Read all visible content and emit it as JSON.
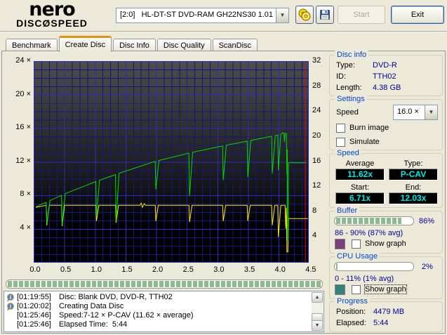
{
  "toolbar": {
    "logo_top": "nero",
    "logo_bottom": "DISCØSPEED",
    "drive_selector": "[2:0]   HL-DT-ST DVD-RAM GH22NS30 1.01",
    "start_label": "Start",
    "exit_label": "Exit"
  },
  "tabs": {
    "items": [
      {
        "label": "Benchmark",
        "active": false
      },
      {
        "label": "Create Disc",
        "active": true
      },
      {
        "label": "Disc Info",
        "active": false
      },
      {
        "label": "Disc Quality",
        "active": false
      },
      {
        "label": "ScanDisc",
        "active": false
      }
    ]
  },
  "chart_data": {
    "type": "line",
    "title": "Create Disc write transfer graph",
    "x_ticks": [
      "0.0",
      "0.5",
      "1.0",
      "1.5",
      "2.0",
      "2.5",
      "3.0",
      "3.5",
      "4.0",
      "4.5"
    ],
    "x_unit": "GB",
    "left_axis": {
      "suffix": "×",
      "ticks": [
        24,
        20,
        16,
        12,
        8,
        4
      ],
      "range": [
        0,
        24
      ]
    },
    "right_axis": {
      "ticks": [
        32,
        28,
        24,
        20,
        16,
        12,
        8,
        4
      ],
      "range": [
        0,
        32
      ]
    },
    "grid": true,
    "capacity_marker_gb": 4.4,
    "capacity_marker_color": "#d41414",
    "series": [
      {
        "name": "rotation-speed-line",
        "color": "#ffe800",
        "axis": "left",
        "points": [
          [
            0,
            6.55
          ],
          [
            0.17,
            6.8
          ],
          [
            0.18,
            4.4
          ],
          [
            0.22,
            6.8
          ],
          [
            0.42,
            6.8
          ],
          [
            0.43,
            4.3
          ],
          [
            0.47,
            6.8
          ],
          [
            0.98,
            6.8
          ],
          [
            0.99,
            4.9
          ],
          [
            1.03,
            6.8
          ],
          [
            1.3,
            6.8
          ],
          [
            1.31,
            4.7
          ],
          [
            1.35,
            6.8
          ],
          [
            1.7,
            6.8
          ],
          [
            1.72,
            7.05
          ],
          [
            1.74,
            6.55
          ],
          [
            1.77,
            7.0
          ],
          [
            1.79,
            6.8
          ],
          [
            1.95,
            6.8
          ],
          [
            1.96,
            4.9
          ],
          [
            2.0,
            6.8
          ],
          [
            2.5,
            6.8
          ],
          [
            2.51,
            4.8
          ],
          [
            2.55,
            6.8
          ],
          [
            3.05,
            6.8
          ],
          [
            3.06,
            4.9
          ],
          [
            3.1,
            6.8
          ],
          [
            3.45,
            6.8
          ],
          [
            3.46,
            4.9
          ],
          [
            3.5,
            6.8
          ],
          [
            3.85,
            6.8
          ],
          [
            3.86,
            4.4
          ],
          [
            3.9,
            6.8
          ],
          [
            3.95,
            6.8
          ],
          [
            3.96,
            3.0
          ],
          [
            4.0,
            6.8
          ],
          [
            4.07,
            6.8
          ],
          [
            4.08,
            4.0
          ],
          [
            4.09,
            6.5
          ],
          [
            4.1,
            1.2
          ],
          [
            4.115,
            1.2
          ],
          [
            4.125,
            5.2
          ],
          [
            4.45,
            5.2
          ]
        ]
      },
      {
        "name": "write-speed-line",
        "color": "#00dc00",
        "axis": "left",
        "points": [
          [
            0,
            6.6
          ],
          [
            0.17,
            7.16
          ],
          [
            0.18,
            4.6
          ],
          [
            0.23,
            7.36
          ],
          [
            0.42,
            7.99
          ],
          [
            0.43,
            4.5
          ],
          [
            0.48,
            8.19
          ],
          [
            0.98,
            9.64
          ],
          [
            0.99,
            5.4
          ],
          [
            1.04,
            9.8
          ],
          [
            1.3,
            10.48
          ],
          [
            1.31,
            4.9
          ],
          [
            1.36,
            10.64
          ],
          [
            1.95,
            12.06
          ],
          [
            1.96,
            8.7
          ],
          [
            2.01,
            12.17
          ],
          [
            2.5,
            13.05
          ],
          [
            2.51,
            7.9
          ],
          [
            2.56,
            13.15
          ],
          [
            3.05,
            13.92
          ],
          [
            3.06,
            9.8
          ],
          [
            3.11,
            14.0
          ],
          [
            3.45,
            14.48
          ],
          [
            3.46,
            10.2
          ],
          [
            3.51,
            14.56
          ],
          [
            3.85,
            15.07
          ],
          [
            3.86,
            10.6
          ],
          [
            3.91,
            15.16
          ],
          [
            3.95,
            15.22
          ],
          [
            3.96,
            11.0
          ],
          [
            4.0,
            15.3
          ],
          [
            4.02,
            15.45
          ],
          [
            4.05,
            15.45
          ],
          [
            4.06,
            14.4
          ],
          [
            4.07,
            15.4
          ],
          [
            4.09,
            15.4
          ],
          [
            4.1,
            10.5
          ],
          [
            4.105,
            13.5
          ],
          [
            4.11,
            2.6
          ],
          [
            4.12,
            2.6
          ],
          [
            4.125,
            11.9
          ],
          [
            4.4,
            11.9
          ]
        ]
      }
    ]
  },
  "right_panel": {
    "disc_info": {
      "title": "Disc info",
      "type_label": "Type:",
      "type": "DVD-R",
      "id_label": "ID:",
      "id": "TTH02",
      "length_label": "Length:",
      "length": "4.38 GB"
    },
    "settings": {
      "title": "Settings",
      "speed_label": "Speed",
      "speed_value": "16.0 ×",
      "burn_image_label": "Burn image",
      "simulate_label": "Simulate"
    },
    "speed": {
      "title": "Speed",
      "average_label": "Average",
      "average": "11.62x",
      "type_label": "Type:",
      "type": "P-CAV",
      "start_label": "Start:",
      "start": "6.71x",
      "end_label": "End:",
      "end": "12.03x"
    },
    "buffer": {
      "title": "Buffer",
      "percent": 86,
      "percent_label": "86%",
      "range": "86 - 90% (87% avg)",
      "show_graph_label": "Show graph",
      "swatch_color": "#7b3d7c"
    },
    "cpu": {
      "title": "CPU Usage",
      "percent": 2,
      "percent_label": "2%",
      "range": "0 - 11% (1% avg)",
      "show_graph_label": "Show graph",
      "swatch_color": "#36807e"
    },
    "progress": {
      "title": "Progress",
      "position_label": "Position:",
      "position": "4479 MB",
      "elapsed_label": "Elapsed:",
      "elapsed": "5:44"
    }
  },
  "status": {
    "progress_percent": 100
  },
  "log": {
    "entries": [
      {
        "time": "[01:19:55]",
        "text": "Disc: Blank DVD, DVD-R, TTH02",
        "icon": true
      },
      {
        "time": "[01:20:02]",
        "text": "Creating Data Disc",
        "icon": true
      },
      {
        "time": "[01:25:46]",
        "text": "Speed:7-12 × P-CAV (11.62 × average)",
        "icon": false
      },
      {
        "time": "[01:25:46]",
        "text": "Elapsed Time:  5:44",
        "icon": false
      }
    ]
  }
}
